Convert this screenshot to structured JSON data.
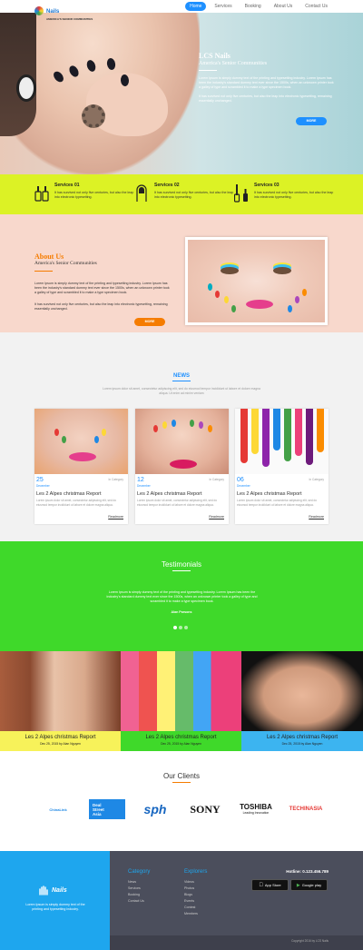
{
  "brand": {
    "name": "Nails",
    "tagline": "AMERICA'S SENIOR COMMUNITIES"
  },
  "nav": [
    {
      "label": "Home",
      "active": true
    },
    {
      "label": "Services",
      "active": false
    },
    {
      "label": "Booking",
      "active": false
    },
    {
      "label": "About Us",
      "active": false
    },
    {
      "label": "Contact Us",
      "active": false
    }
  ],
  "hero": {
    "title": "LCS Nails",
    "subtitle": "America's Senior Communities",
    "paragraph1": "Lorem Ipsum is simply dummy text of the printing and typesetting industry. Lorem Ipsum has been the industry's standard dummy text ever since the 1500s, when an unknown printer took a galley of type and scrambled it to make a type specimen book.",
    "paragraph2": "It has survived not only five centuries, but also the leap into electronic typesetting, remaining essentially unchanged.",
    "button": "MORE"
  },
  "services": [
    {
      "title": "Services 01",
      "text": "It has survived not only five centuries, but also the leap into electronic typesetting.",
      "icon": "nail-polish-icon"
    },
    {
      "title": "Services 02",
      "text": "It has survived not only five centuries, but also the leap into electronic typesetting.",
      "icon": "fingernail-icon"
    },
    {
      "title": "Services 03",
      "text": "It has survived not only five centuries, but also the leap into electronic typesetting.",
      "icon": "nail-file-icon"
    }
  ],
  "about": {
    "title": "About Us",
    "subtitle": "America's Senior Communities",
    "paragraph1": "Lorem Ipsum is simply dummy text of the printing and typesetting industry. Lorem Ipsum has been the industry's standard dummy text ever since the 1500s, when an unknown printer took a galley of type and scrambled it to make a type specimen book.",
    "paragraph2": "It has survived not only five centuries, but also the leap into electronic typesetting, remaining essentially unchanged.",
    "button": "MORE"
  },
  "news": {
    "title": "NEWS",
    "intro": "Lorem ipsum dolor sit amet, consectetur adipiscing elit, sed do eiusmod tempor incididunt ut labore et dolore magna aliqua. Ut enim ad minim veniam",
    "cards": [
      {
        "day": "25",
        "month": "December",
        "category": "In Category",
        "title": "Les 2 Alpes christmas Report",
        "text": "Lorem ipsum dolor sit amet, consectetur adipiscing elit, sed do eiusmod tempor incididunt ut labore et dolore magna aliqua.",
        "more": "Readmore"
      },
      {
        "day": "12",
        "month": "December",
        "category": "In Category",
        "title": "Les 2 Alpes christmas Report",
        "text": "Lorem ipsum dolor sit amet, consectetur adipiscing elit, sed do eiusmod tempor incididunt ut labore et dolore magna aliqua.",
        "more": "Readmore"
      },
      {
        "day": "06",
        "month": "December",
        "category": "In Category",
        "title": "Les 2 Alpes christmas Report",
        "text": "Lorem ipsum dolor sit amet, consectetur adipiscing elit, sed do eiusmod tempor incididunt ut labore et dolore magna aliqua.",
        "more": "Readmore"
      }
    ]
  },
  "testimonials": {
    "title": "Testimonials",
    "text": "Lorem Ipsum is simply dummy text of the printing and typesetting industry. Lorem Ipsum has been the industry's standard dummy text ever since the 1500s, when an unknown printer took a galley of type and scrambled it to make a type specimen book.",
    "author": "Alan Parsons"
  },
  "gallery": [
    {
      "title": "Les 2 Alpes christmas Report",
      "date": "Dec 25, 2015 by Alan Nguyen",
      "color": "#f7f25a"
    },
    {
      "title": "Les 2 Alpes christmas Report",
      "date": "Dec 25, 2015 by Alan Nguyen",
      "color": "#3fd92a"
    },
    {
      "title": "Les 2 Alpes christmas Report",
      "date": "Dec 25, 2015 by Alan Nguyen",
      "color": "#3cb4f0"
    }
  ],
  "clients": {
    "title": "Our Clients",
    "logos": [
      {
        "name": "ChinaLink Logo",
        "text": "ChinaLink"
      },
      {
        "name": "deal-street-asia-logo",
        "text1": "Deal",
        "text2": "Street",
        "text3": "Asia"
      },
      {
        "name": "sph-logo",
        "text": "sph"
      },
      {
        "name": "sony-logo",
        "text": "SONY"
      },
      {
        "name": "toshiba-logo",
        "text1": "TOSHIBA",
        "text2": "Leading Innovation"
      },
      {
        "name": "techinasia-logo",
        "text": "TECHINASIA"
      }
    ]
  },
  "footer": {
    "brand": "Nails",
    "about": "Lorem Ipsum is simply dummy text of the printing and typesetting industry.",
    "category_title": "Category",
    "category_links": [
      "News",
      "Services",
      "Booking",
      "Contact Us"
    ],
    "explorers_title": "Explorers",
    "explorers_links": [
      "Videos",
      "Photos",
      "Blogs",
      "Events",
      "Contest",
      "Members"
    ],
    "hotline": "Hotline: 0.123.456.789",
    "app_store": "App Store",
    "google_play": "Google play",
    "copyright": "Copyright 2016 by LCS Nails"
  }
}
